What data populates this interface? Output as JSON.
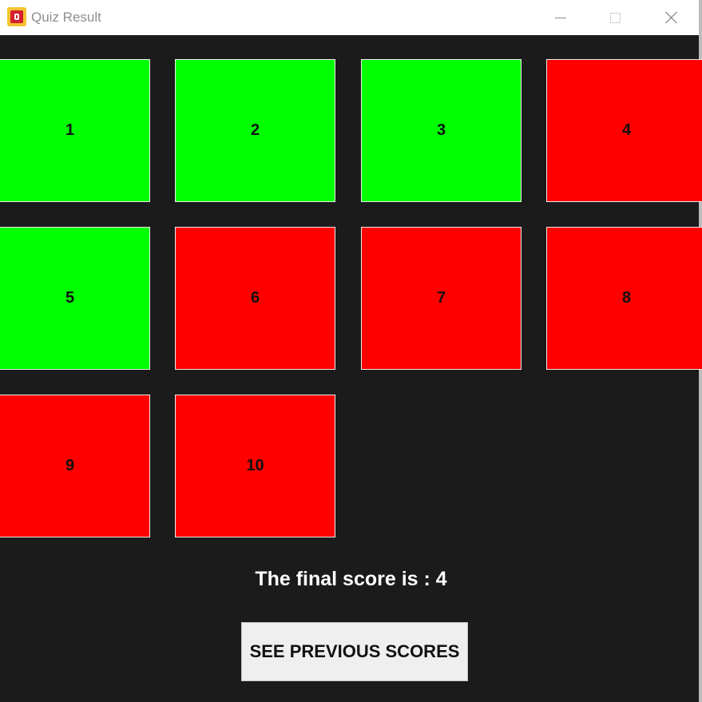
{
  "window": {
    "title": "Quiz Result",
    "icon": "app-icon",
    "controls": {
      "minimize_icon": "minimize-icon",
      "maximize_icon": "maximize-icon",
      "close_icon": "close-icon"
    }
  },
  "results": {
    "items": [
      {
        "number": "1",
        "status": "correct",
        "color": "#00ff00"
      },
      {
        "number": "2",
        "status": "correct",
        "color": "#00ff00"
      },
      {
        "number": "3",
        "status": "correct",
        "color": "#00ff00"
      },
      {
        "number": "4",
        "status": "wrong",
        "color": "#ff0000"
      },
      {
        "number": "5",
        "status": "correct",
        "color": "#00ff00"
      },
      {
        "number": "6",
        "status": "wrong",
        "color": "#ff0000"
      },
      {
        "number": "7",
        "status": "wrong",
        "color": "#ff0000"
      },
      {
        "number": "8",
        "status": "wrong",
        "color": "#ff0000"
      },
      {
        "number": "9",
        "status": "wrong",
        "color": "#ff0000"
      },
      {
        "number": "10",
        "status": "wrong",
        "color": "#ff0000"
      }
    ]
  },
  "score": {
    "text": "The final score is : 4"
  },
  "buttons": {
    "see_previous_scores": "SEE PREVIOUS SCORES"
  },
  "colors": {
    "background": "#1b1b1b",
    "correct": "#00ff00",
    "wrong": "#ff0000"
  }
}
